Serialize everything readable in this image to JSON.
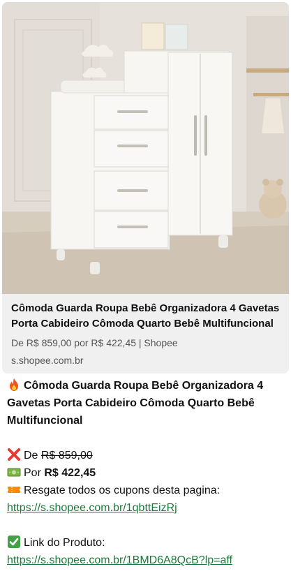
{
  "preview": {
    "image_icon": "wardrobe-dresser-photo",
    "title": "Cômoda Guarda Roupa Bebê Organizadora 4 Gavetas Porta Cabideiro Cômoda Quarto Bebê Multifuncional",
    "description": "De R$ 859,00 por R$ 422,45 | Shopee",
    "domain": "s.shopee.com.br"
  },
  "message": {
    "title": "Cômoda Guarda Roupa Bebê Organizadora 4 Gavetas Porta Cabideiro Cômoda Quarto Bebê Multifuncional",
    "old_price_prefix": "De",
    "old_price": "R$ 859,00",
    "new_price_prefix": "Por",
    "new_price": "R$ 422,45",
    "coupon_text": "Resgate todos os cupons desta pagina:",
    "coupon_link": "https://s.shopee.com.br/1qbttEizRj",
    "product_label": "Link do Produto:",
    "product_link": "https://s.shopee.com.br/1BMD6A8QcB?lp=aff"
  },
  "icons": {
    "fire": "fire-icon",
    "cross": "red-x-icon",
    "money": "banknote-icon",
    "ticket": "ticket-icon",
    "check": "check-box-icon"
  },
  "colors": {
    "link": "#1b7a3a",
    "card_bg": "#f0f0f0"
  }
}
